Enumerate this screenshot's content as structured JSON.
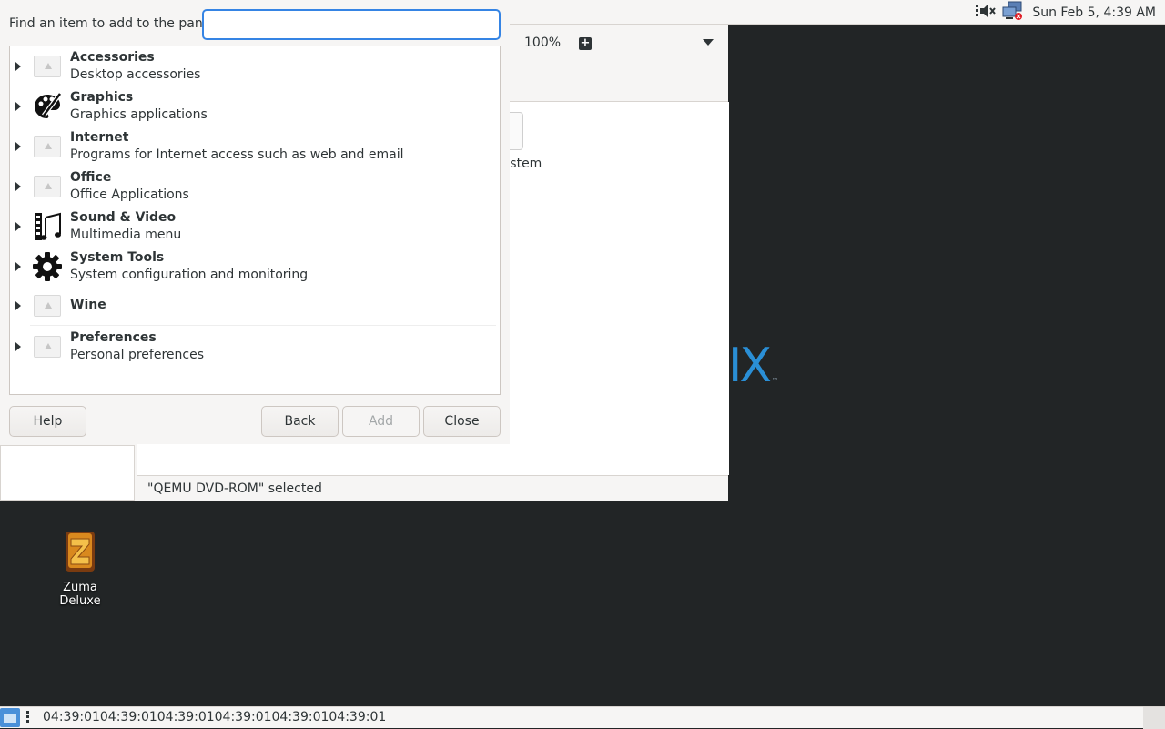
{
  "top_panel": {
    "clock": "Sun Feb  5,  4:39 AM",
    "tray_icons": [
      "speaker-muted-icon",
      "network-disconnected-icon"
    ]
  },
  "file_manager": {
    "zoom": "100%",
    "partial_item_label": "ystem",
    "status": "\"QEMU DVD-ROM\" selected"
  },
  "desktop": {
    "logo_fragment": "IX",
    "logo_tm": "™",
    "icons": [
      {
        "label": "Zuma Deluxe"
      }
    ]
  },
  "dialog": {
    "search_label": "Find an item to add to the panel:",
    "search_value": "",
    "items": [
      {
        "title": "Accessories",
        "description": "Desktop accessories",
        "icon": "placeholder-icon"
      },
      {
        "title": "Graphics",
        "description": "Graphics applications",
        "icon": "graphics-icon"
      },
      {
        "title": "Internet",
        "description": "Programs for Internet access such as web and email",
        "icon": "placeholder-icon"
      },
      {
        "title": "Office",
        "description": "Office Applications",
        "icon": "placeholder-icon"
      },
      {
        "title": "Sound & Video",
        "description": "Multimedia menu",
        "icon": "multimedia-icon"
      },
      {
        "title": "System Tools",
        "description": "System configuration and monitoring",
        "icon": "gear-icon"
      },
      {
        "title": "Wine",
        "description": "",
        "icon": "placeholder-icon"
      },
      {
        "title": "Preferences",
        "description": "Personal preferences",
        "icon": "placeholder-icon"
      }
    ],
    "buttons": {
      "help": "Help",
      "back": "Back",
      "add": "Add",
      "close": "Close"
    }
  },
  "bottom_panel": {
    "task_text": "04:39:0104:39:0104:39:0104:39:0104:39:0104:39:01"
  }
}
